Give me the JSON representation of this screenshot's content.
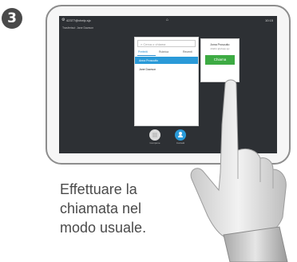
{
  "step": {
    "number": "3"
  },
  "screen": {
    "status_left": "42377@vhelp.sjc",
    "status_right": "10:15",
    "call_label": "Trasferisci: Jane Dawson",
    "search": {
      "placeholder": "Cerca o chiama"
    },
    "tabs": [
      {
        "label": "Preferiti",
        "selected": true
      },
      {
        "label": "Rubrica",
        "selected": false
      },
      {
        "label": "Recenti",
        "selected": false
      }
    ],
    "contacts": [
      {
        "name": "Anna Proscutto",
        "selected": true
      },
      {
        "name": "Jane Dawson",
        "selected": false
      }
    ],
    "callee": {
      "name": "Anna Proscutto",
      "address": "43221 @vhelp.sjc",
      "call_label": "Chiama"
    },
    "dock": [
      {
        "label": "Compone",
        "icon": "keypad-icon"
      },
      {
        "label": "Contatti",
        "icon": "person-icon"
      }
    ]
  },
  "instruction": "Effettuare la\nchiamata nel\nmodo usuale.",
  "colors": {
    "accent": "#2a9ad8",
    "call_green": "#3dab43",
    "screen_bg": "#2d3034"
  }
}
